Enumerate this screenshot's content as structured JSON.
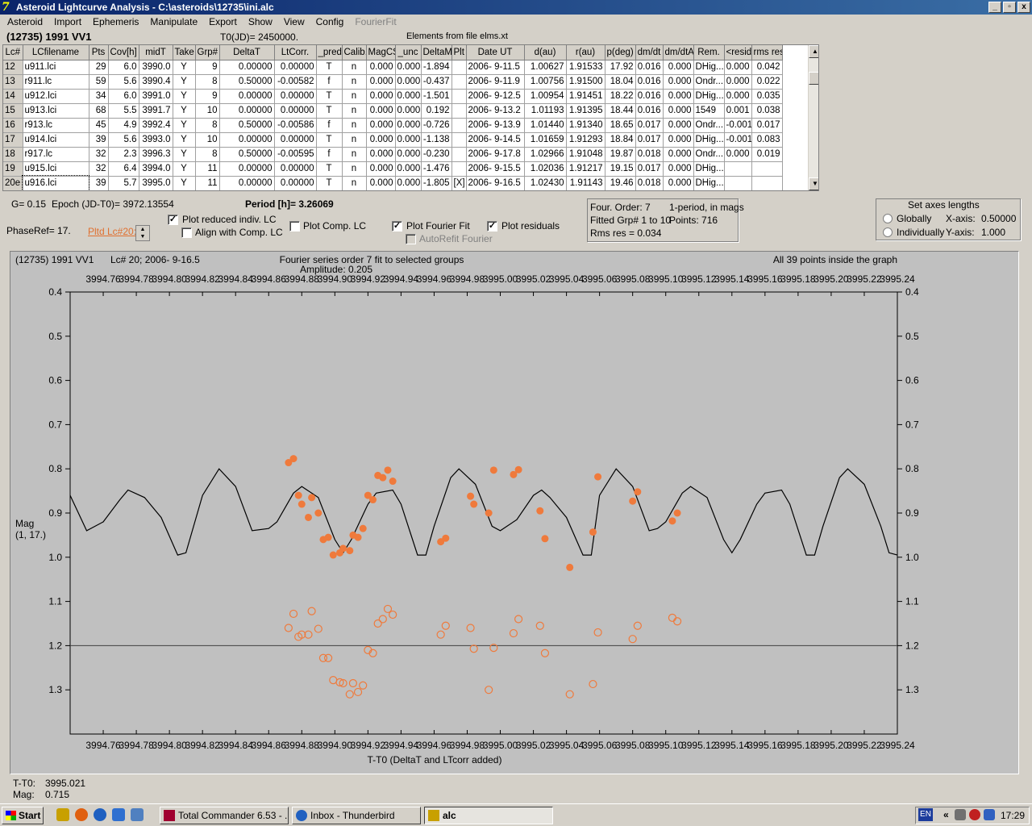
{
  "window": {
    "title": "Asteroid Lightcurve Analysis - C:\\asteroids\\12735\\ini.alc",
    "min": "_",
    "max": "▫",
    "close": "x"
  },
  "menu": [
    "Asteroid",
    "Import",
    "Ephemeris",
    "Manipulate",
    "Export",
    "Show",
    "View",
    "Config",
    "FourierFit"
  ],
  "header": {
    "asteroid": "(12735) 1991 VV1",
    "t0": "T0(JD)= 2450000.",
    "elements": "Elements from file elms.xt"
  },
  "grid": {
    "columns": [
      "Lc#",
      "LCfilename",
      "Pts",
      "Cov[h]",
      "midT",
      "Take",
      "Grp#",
      "DeltaT",
      "LtCorr.",
      "_pred.",
      "Calib.",
      "MagCS",
      "_unc",
      "DeltaM",
      "Plt",
      "Date UT",
      "d(au)",
      "r(au)",
      "p(deg)",
      "dm/dt",
      "dm/dtA",
      "Rem.",
      "<resid>",
      "rms res"
    ],
    "rows": [
      [
        "12",
        "u911.lci",
        "29",
        "6.0",
        "3990.0",
        "Y",
        "9",
        "0.00000",
        "0.00000",
        "T",
        "n",
        "0.000",
        "0.000",
        "-1.894",
        "",
        "2006- 9-11.5",
        "1.00627",
        "1.91533",
        "17.92",
        "0.016",
        "0.000",
        "DHig...",
        "0.000",
        "0.042"
      ],
      [
        "13",
        "r911.lc",
        "59",
        "5.6",
        "3990.4",
        "Y",
        "8",
        "0.50000",
        "-0.00582",
        "f",
        "n",
        "0.000",
        "0.000",
        "-0.437",
        "",
        "2006- 9-11.9",
        "1.00756",
        "1.91500",
        "18.04",
        "0.016",
        "0.000",
        "Ondr...",
        "0.000",
        "0.022"
      ],
      [
        "14",
        "u912.lci",
        "34",
        "6.0",
        "3991.0",
        "Y",
        "9",
        "0.00000",
        "0.00000",
        "T",
        "n",
        "0.000",
        "0.000",
        "-1.501",
        "",
        "2006- 9-12.5",
        "1.00954",
        "1.91451",
        "18.22",
        "0.016",
        "0.000",
        "DHig...",
        "0.000",
        "0.035"
      ],
      [
        "15",
        "u913.lci",
        "68",
        "5.5",
        "3991.7",
        "Y",
        "10",
        "0.00000",
        "0.00000",
        "T",
        "n",
        "0.000",
        "0.000",
        "0.192",
        "",
        "2006- 9-13.2",
        "1.01193",
        "1.91395",
        "18.44",
        "0.016",
        "0.000",
        "1549",
        "0.001",
        "0.038"
      ],
      [
        "16",
        "r913.lc",
        "45",
        "4.9",
        "3992.4",
        "Y",
        "8",
        "0.50000",
        "-0.00586",
        "f",
        "n",
        "0.000",
        "0.000",
        "-0.726",
        "",
        "2006- 9-13.9",
        "1.01440",
        "1.91340",
        "18.65",
        "0.017",
        "0.000",
        "Ondr...",
        "-0.001",
        "0.017"
      ],
      [
        "17",
        "u914.lci",
        "39",
        "5.6",
        "3993.0",
        "Y",
        "10",
        "0.00000",
        "0.00000",
        "T",
        "n",
        "0.000",
        "0.000",
        "-1.138",
        "",
        "2006- 9-14.5",
        "1.01659",
        "1.91293",
        "18.84",
        "0.017",
        "0.000",
        "DHig...",
        "-0.001",
        "0.083"
      ],
      [
        "18",
        "r917.lc",
        "32",
        "2.3",
        "3996.3",
        "Y",
        "8",
        "0.50000",
        "-0.00595",
        "f",
        "n",
        "0.000",
        "0.000",
        "-0.230",
        "",
        "2006- 9-17.8",
        "1.02966",
        "1.91048",
        "19.87",
        "0.018",
        "0.000",
        "Ondr...",
        "0.000",
        "0.019"
      ],
      [
        "19",
        "u915.lci",
        "32",
        "6.4",
        "3994.0",
        "Y",
        "11",
        "0.00000",
        "0.00000",
        "T",
        "n",
        "0.000",
        "0.000",
        "-1.476",
        "",
        "2006- 9-15.5",
        "1.02036",
        "1.91217",
        "19.15",
        "0.017",
        "0.000",
        "DHig...",
        "",
        ""
      ],
      [
        "20e",
        "u916.lci",
        "39",
        "5.7",
        "3995.0",
        "Y",
        "11",
        "0.00000",
        "0.00000",
        "T",
        "n",
        "0.000",
        "0.000",
        "-1.805",
        "[X]",
        "2006- 9-16.5",
        "1.02430",
        "1.91143",
        "19.46",
        "0.018",
        "0.000",
        "DHig...",
        "",
        ""
      ]
    ]
  },
  "controls": {
    "g": "G= 0.15",
    "epoch": "Epoch (JD-T0)= 3972.13554",
    "period": "Period [h]= 3.26069",
    "phaseref": "PhaseRef= 17.",
    "pltd": "Pltd Lc#20:",
    "plot_reduced": "Plot reduced indiv. LC",
    "align_comp": "Align with Comp. LC",
    "plot_comp": "Plot Comp. LC",
    "plot_fourier": "Plot Fourier Fit",
    "plot_residuals": "Plot residuals",
    "autorefit": "AutoRefit Fourier",
    "check": "✓"
  },
  "fourier_info": {
    "order": "Four. Order:  7",
    "mode": "1-period, in mags",
    "fitted": "Fitted Grp# 1 to 10",
    "points": "Points: 716",
    "rms": "Rms res     = 0.034"
  },
  "axes_box": {
    "title": "Set axes lengths",
    "globally": "Globally",
    "individually": "Individually",
    "x_label": "X-axis:",
    "x_val": "0.50000",
    "y_label": "Y-axis:",
    "y_val": "1.000"
  },
  "plot": {
    "name": "(12735) 1991 VV1",
    "lc": "Lc# 20; 2006- 9-16.5",
    "fit_title": "Fourier series order 7 fit to selected groups",
    "amplitude": "Amplitude: 0.205",
    "inside": "All 39 points inside the graph",
    "xlabel": "T-T0 (DeltaT and LTcorr added)",
    "ylabel1": "Mag",
    "ylabel2": "(1, 17.)"
  },
  "chart_data": {
    "type": "scatter",
    "x_range": [
      3994.74,
      3995.24
    ],
    "y_range": [
      0.4,
      1.4
    ],
    "y_inverted": true,
    "x_ticks": [
      "3994.76",
      "3994.78",
      "3994.80",
      "3994.82",
      "3994.84",
      "3994.86",
      "3994.88",
      "3994.90",
      "3994.92",
      "3994.94",
      "3994.96",
      "3994.98",
      "3995.00",
      "3995.02",
      "3995.04",
      "3995.06",
      "3995.08",
      "3995.10",
      "3995.12",
      "3995.14",
      "3995.16",
      "3995.18",
      "3995.20",
      "3995.22",
      "3995.24"
    ],
    "y_ticks": [
      "0.4",
      "0.5",
      "0.6",
      "0.7",
      "0.8",
      "0.9",
      "1.0",
      "1.1",
      "1.2",
      "1.3"
    ],
    "residual_reference": 1.2,
    "point_color": "#ef7a3c",
    "fit_color": "#000000",
    "observed": [
      [
        3994.872,
        0.786
      ],
      [
        3994.875,
        0.777
      ],
      [
        3994.878,
        0.86
      ],
      [
        3994.88,
        0.88
      ],
      [
        3994.884,
        0.91
      ],
      [
        3994.886,
        0.865
      ],
      [
        3994.89,
        0.9
      ],
      [
        3994.893,
        0.96
      ],
      [
        3994.896,
        0.955
      ],
      [
        3994.899,
        0.995
      ],
      [
        3994.903,
        0.99
      ],
      [
        3994.905,
        0.98
      ],
      [
        3994.909,
        0.985
      ],
      [
        3994.911,
        0.95
      ],
      [
        3994.914,
        0.955
      ],
      [
        3994.917,
        0.935
      ],
      [
        3994.92,
        0.86
      ],
      [
        3994.923,
        0.87
      ],
      [
        3994.926,
        0.815
      ],
      [
        3994.929,
        0.82
      ],
      [
        3994.932,
        0.803
      ],
      [
        3994.935,
        0.828
      ],
      [
        3994.964,
        0.965
      ],
      [
        3994.967,
        0.957
      ],
      [
        3994.982,
        0.862
      ],
      [
        3994.984,
        0.88
      ],
      [
        3994.993,
        0.9
      ],
      [
        3994.996,
        0.803
      ],
      [
        3995.008,
        0.813
      ],
      [
        3995.011,
        0.802
      ],
      [
        3995.024,
        0.895
      ],
      [
        3995.027,
        0.958
      ],
      [
        3995.042,
        1.023
      ],
      [
        3995.056,
        0.943
      ],
      [
        3995.059,
        0.818
      ],
      [
        3995.08,
        0.873
      ],
      [
        3995.083,
        0.852
      ],
      [
        3995.104,
        0.918
      ],
      [
        3995.107,
        0.9
      ]
    ],
    "residuals": [
      [
        3994.872,
        1.16
      ],
      [
        3994.875,
        1.128
      ],
      [
        3994.878,
        1.18
      ],
      [
        3994.88,
        1.175
      ],
      [
        3994.884,
        1.175
      ],
      [
        3994.886,
        1.122
      ],
      [
        3994.89,
        1.162
      ],
      [
        3994.893,
        1.228
      ],
      [
        3994.896,
        1.228
      ],
      [
        3994.899,
        1.278
      ],
      [
        3994.903,
        1.283
      ],
      [
        3994.905,
        1.285
      ],
      [
        3994.909,
        1.31
      ],
      [
        3994.911,
        1.285
      ],
      [
        3994.914,
        1.305
      ],
      [
        3994.917,
        1.29
      ],
      [
        3994.92,
        1.21
      ],
      [
        3994.923,
        1.217
      ],
      [
        3994.926,
        1.15
      ],
      [
        3994.929,
        1.14
      ],
      [
        3994.932,
        1.117
      ],
      [
        3994.935,
        1.13
      ],
      [
        3994.964,
        1.175
      ],
      [
        3994.967,
        1.155
      ],
      [
        3994.982,
        1.16
      ],
      [
        3994.984,
        1.207
      ],
      [
        3994.993,
        1.3
      ],
      [
        3994.996,
        1.205
      ],
      [
        3995.008,
        1.172
      ],
      [
        3995.011,
        1.14
      ],
      [
        3995.024,
        1.155
      ],
      [
        3995.027,
        1.217
      ],
      [
        3995.042,
        1.31
      ],
      [
        3995.056,
        1.287
      ],
      [
        3995.059,
        1.17
      ],
      [
        3995.08,
        1.185
      ],
      [
        3995.083,
        1.155
      ],
      [
        3995.104,
        1.137
      ],
      [
        3995.107,
        1.145
      ]
    ],
    "fourier_fit": [
      [
        3994.74,
        0.86
      ],
      [
        3994.75,
        0.94
      ],
      [
        3994.76,
        0.92
      ],
      [
        3994.77,
        0.87
      ],
      [
        3994.775,
        0.848
      ],
      [
        3994.785,
        0.865
      ],
      [
        3994.795,
        0.91
      ],
      [
        3994.805,
        0.995
      ],
      [
        3994.81,
        0.99
      ],
      [
        3994.82,
        0.86
      ],
      [
        3994.83,
        0.8
      ],
      [
        3994.84,
        0.84
      ],
      [
        3994.85,
        0.94
      ],
      [
        3994.86,
        0.935
      ],
      [
        3994.865,
        0.92
      ],
      [
        3994.875,
        0.855
      ],
      [
        3994.88,
        0.84
      ],
      [
        3994.89,
        0.865
      ],
      [
        3994.9,
        0.96
      ],
      [
        3994.905,
        0.99
      ],
      [
        3994.91,
        0.96
      ],
      [
        3994.92,
        0.88
      ],
      [
        3994.925,
        0.855
      ],
      [
        3994.935,
        0.848
      ],
      [
        3994.94,
        0.88
      ],
      [
        3994.95,
        0.995
      ],
      [
        3994.955,
        0.995
      ],
      [
        3994.96,
        0.93
      ],
      [
        3994.97,
        0.82
      ],
      [
        3994.975,
        0.8
      ],
      [
        3994.985,
        0.835
      ],
      [
        3994.995,
        0.93
      ],
      [
        3995.0,
        0.94
      ],
      [
        3995.01,
        0.915
      ],
      [
        3995.02,
        0.86
      ],
      [
        3995.025,
        0.848
      ],
      [
        3995.03,
        0.865
      ],
      [
        3995.04,
        0.91
      ],
      [
        3995.05,
        0.995
      ],
      [
        3995.055,
        0.995
      ],
      [
        3995.06,
        0.86
      ],
      [
        3995.07,
        0.8
      ],
      [
        3995.08,
        0.84
      ],
      [
        3995.09,
        0.94
      ],
      [
        3995.095,
        0.935
      ],
      [
        3995.1,
        0.92
      ],
      [
        3995.11,
        0.855
      ],
      [
        3995.115,
        0.84
      ],
      [
        3995.125,
        0.865
      ],
      [
        3995.135,
        0.96
      ],
      [
        3995.14,
        0.99
      ],
      [
        3995.145,
        0.96
      ],
      [
        3995.155,
        0.88
      ],
      [
        3995.16,
        0.855
      ],
      [
        3995.17,
        0.848
      ],
      [
        3995.175,
        0.88
      ],
      [
        3995.185,
        0.995
      ],
      [
        3995.19,
        0.995
      ],
      [
        3995.195,
        0.93
      ],
      [
        3995.205,
        0.82
      ],
      [
        3995.21,
        0.8
      ],
      [
        3995.22,
        0.835
      ],
      [
        3995.23,
        0.93
      ],
      [
        3995.235,
        0.99
      ],
      [
        3995.24,
        0.995
      ]
    ]
  },
  "status": {
    "t_label": "T-T0:",
    "t_val": "3995.021",
    "mag_label": "Mag:",
    "mag_val": "0.715"
  },
  "taskbar": {
    "start": "Start",
    "tasks": [
      "Total Commander 6.53 - ...",
      "Inbox - Thunderbird",
      "alc"
    ],
    "lang": "EN",
    "arrow": "«",
    "clock": "17:29"
  }
}
